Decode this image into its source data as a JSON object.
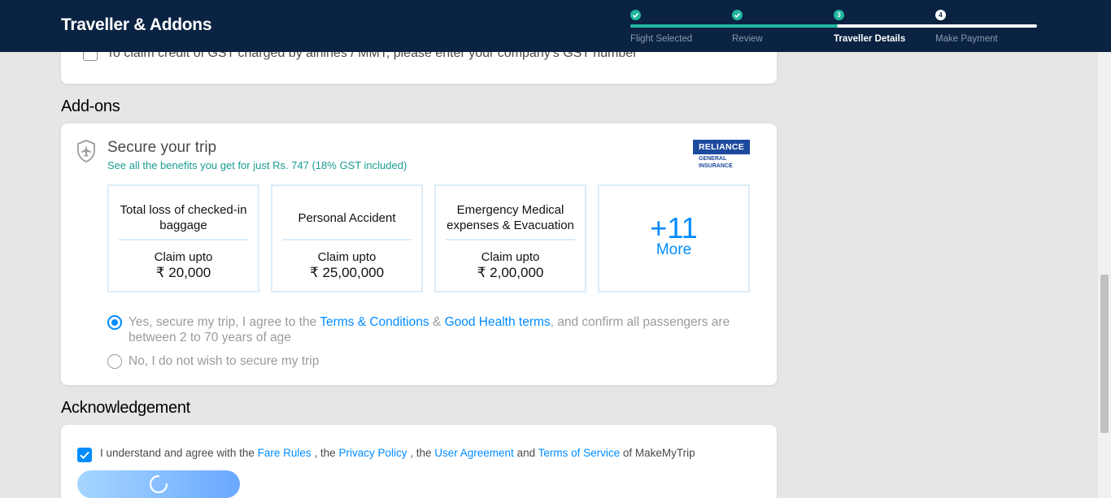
{
  "header": {
    "title": "Traveller & Addons",
    "steps": [
      {
        "number": "✓",
        "label": "Flight Selected"
      },
      {
        "number": "✓",
        "label": "Review"
      },
      {
        "number": "3",
        "label": "Traveller Details"
      },
      {
        "number": "4",
        "label": "Make Payment"
      }
    ]
  },
  "gst": {
    "text": "To claim credit of GST charged by airlines / MMT, please enter your company's GST number"
  },
  "addons": {
    "section_title": "Add-ons",
    "title": "Secure your trip",
    "subtitle": "See all the benefits you get for just Rs. 747 (18% GST included)",
    "logo": {
      "top": "RELIANCE",
      "line1": "GENERAL",
      "line2": "INSURANCE"
    },
    "benefits": [
      {
        "name": "Total loss of checked-in baggage",
        "claim": "Claim upto",
        "amount": "₹ 20,000"
      },
      {
        "name": "Personal Accident",
        "claim": "Claim upto",
        "amount": "₹ 25,00,000"
      },
      {
        "name": "Emergency Medical expenses & Evacuation",
        "claim": "Claim upto",
        "amount": "₹ 2,00,000"
      }
    ],
    "more": {
      "count": "+11",
      "label": "More"
    },
    "yes_option": {
      "prefix": "Yes, secure my trip, I agree to the ",
      "link1": "Terms & Conditions",
      "amp": " & ",
      "link2": "Good Health terms",
      "suffix": ", and confirm all passengers are between 2 to 70 years of age",
      "selected": true
    },
    "no_option": {
      "text": "No, I do not wish to secure my trip",
      "selected": false
    }
  },
  "acknowledgement": {
    "section_title": "Acknowledgement",
    "p1": "I understand and agree with the ",
    "fare_rules": "Fare Rules",
    "p2": " , the ",
    "privacy": "Privacy Policy",
    "p3": " , the ",
    "user_agreement": "User Agreement",
    "p4": " and ",
    "terms": "Terms of Service",
    "p5": " of MakeMyTrip",
    "checked": true
  },
  "colors": {
    "header_bg": "#0a2342",
    "accent": "#008cff",
    "progress": "#22b6a0"
  }
}
